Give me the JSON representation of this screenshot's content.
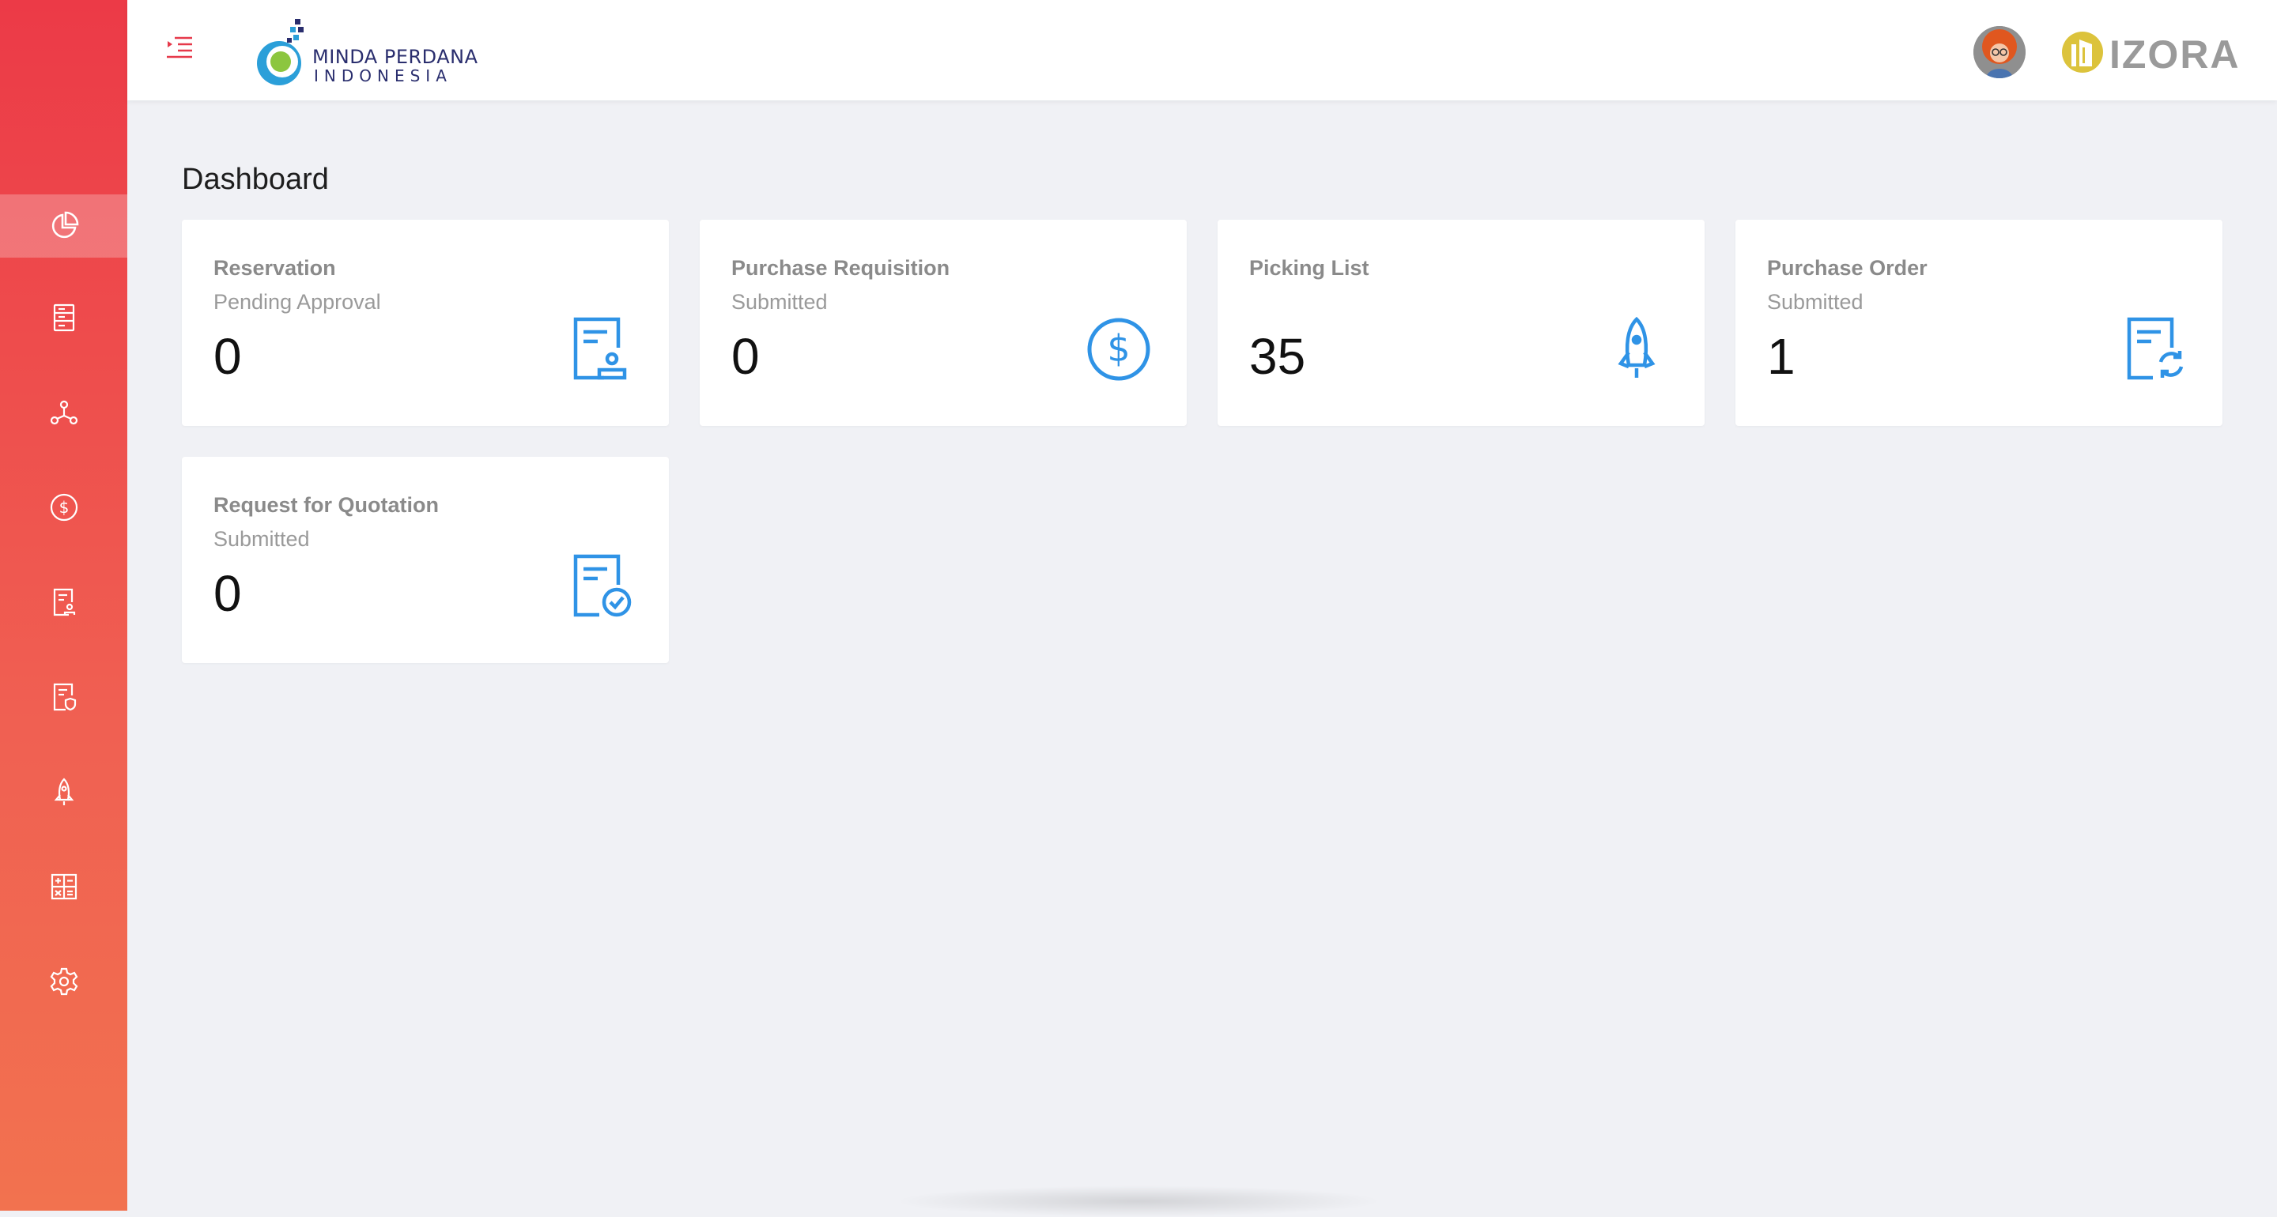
{
  "sidebar": {
    "items": [
      {
        "icon": "pie-chart-icon",
        "active": true
      },
      {
        "icon": "server-list-icon",
        "active": false
      },
      {
        "icon": "network-icon",
        "active": false
      },
      {
        "icon": "dollar-circle-icon",
        "active": false
      },
      {
        "icon": "document-user-icon",
        "active": false
      },
      {
        "icon": "document-shield-icon",
        "active": false
      },
      {
        "icon": "rocket-icon",
        "active": false
      },
      {
        "icon": "calculator-icon",
        "active": false
      },
      {
        "icon": "gear-icon",
        "active": false
      }
    ]
  },
  "header": {
    "logo_line1": "MINDA PERDANA",
    "logo_line2": "INDONESIA",
    "brand": "IZORA"
  },
  "main": {
    "title": "Dashboard",
    "cards": [
      {
        "title": "Reservation",
        "subtitle": "Pending Approval",
        "value": "0",
        "icon": "document-user-icon"
      },
      {
        "title": "Purchase Requisition",
        "subtitle": "Submitted",
        "value": "0",
        "icon": "dollar-circle-icon"
      },
      {
        "title": "Picking List",
        "subtitle": "",
        "value": "35",
        "icon": "rocket-icon"
      },
      {
        "title": "Purchase Order",
        "subtitle": "Submitted",
        "value": "1",
        "icon": "document-refresh-icon"
      },
      {
        "title": "Request for Quotation",
        "subtitle": "Submitted",
        "value": "0",
        "icon": "document-check-icon"
      }
    ]
  },
  "colors": {
    "sidebar_top": "#ec3a47",
    "sidebar_bottom": "#f2724f",
    "accent_icon": "#2f93e6",
    "background": "#f0f1f5"
  }
}
